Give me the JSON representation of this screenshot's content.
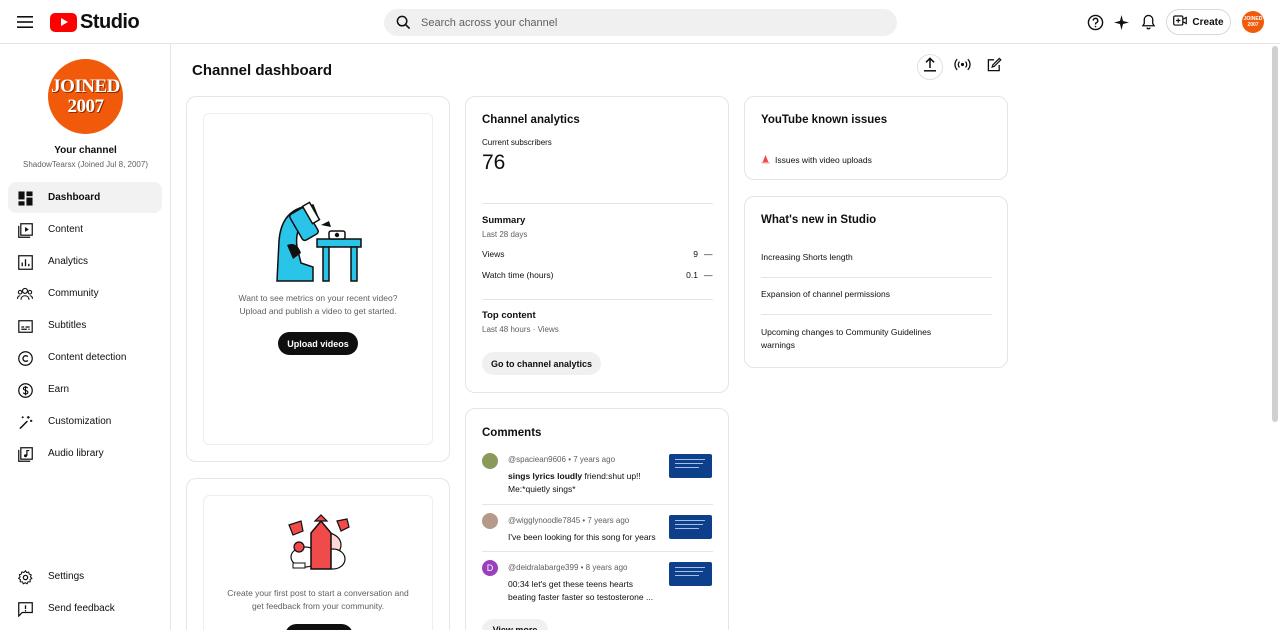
{
  "header": {
    "logo_text": "Studio",
    "search_placeholder": "Search across your channel",
    "create_label": "Create",
    "avatar_text": "JOINED 2007"
  },
  "sidebar": {
    "avatar_line1": "JOINED",
    "avatar_line2": "2007",
    "channel_title": "Your channel",
    "channel_subtitle": "ShadowTearsx (Joined Jul 8, 2007)",
    "items": [
      {
        "label": "Dashboard",
        "icon": "dashboard-icon"
      },
      {
        "label": "Content",
        "icon": "content-icon"
      },
      {
        "label": "Analytics",
        "icon": "analytics-icon"
      },
      {
        "label": "Community",
        "icon": "community-icon"
      },
      {
        "label": "Subtitles",
        "icon": "subtitles-icon"
      },
      {
        "label": "Content detection",
        "icon": "copyright-icon"
      },
      {
        "label": "Earn",
        "icon": "dollar-icon"
      },
      {
        "label": "Customization",
        "icon": "magic-wand-icon"
      },
      {
        "label": "Audio library",
        "icon": "audio-library-icon"
      }
    ],
    "settings_label": "Settings",
    "feedback_label": "Send feedback"
  },
  "main": {
    "title": "Channel dashboard",
    "upload_card": {
      "text_line1": "Want to see metrics on your recent video?",
      "text_line2": "Upload and publish a video to get started.",
      "button": "Upload videos"
    },
    "post_card": {
      "text_line1": "Create your first post to start a conversation and",
      "text_line2": "get feedback from your community."
    },
    "analytics": {
      "title": "Channel analytics",
      "subs_label": "Current subscribers",
      "subs_value": "76",
      "summary_title": "Summary",
      "summary_period": "Last 28 days",
      "rows": [
        {
          "label": "Views",
          "value": "9",
          "trend": "—"
        },
        {
          "label": "Watch time (hours)",
          "value": "0.1",
          "trend": "—"
        }
      ],
      "top_title": "Top content",
      "top_period": "Last 48 hours · Views",
      "button": "Go to channel analytics"
    },
    "comments": {
      "title": "Comments",
      "items": [
        {
          "author": "@spaciean9606",
          "time": "• 7 years ago",
          "bold": "sings lyrics loudly",
          "text": " friend:shut up!! Me:*quietly sings*",
          "avatar_color": "#8a9a5b"
        },
        {
          "author": "@wigglynoodle7845",
          "time": "• 7 years ago",
          "bold": "",
          "text": "I've been looking for this song for years",
          "avatar_color": "#b39a8a"
        },
        {
          "author": "@deidralabarge399",
          "time": "• 8 years ago",
          "bold": "",
          "text": "00:34 let's get these teens hearts beating faster faster so testosterone ...",
          "avatar_color": "#9c3fbf",
          "avatar_letter": "D"
        }
      ],
      "button": "View more"
    },
    "known_issues": {
      "title": "YouTube known issues",
      "item": "Issues with video uploads"
    },
    "whats_new": {
      "title": "What's new in Studio",
      "items": [
        "Increasing Shorts length",
        "Expansion of channel permissions",
        "Upcoming changes to Community Guidelines warnings"
      ]
    }
  },
  "colors": {
    "accent": "#ff0000",
    "avatar_bg": "#f05a0a",
    "illustration_blue": "#29c4e8",
    "illustration_red": "#f04a4a"
  }
}
